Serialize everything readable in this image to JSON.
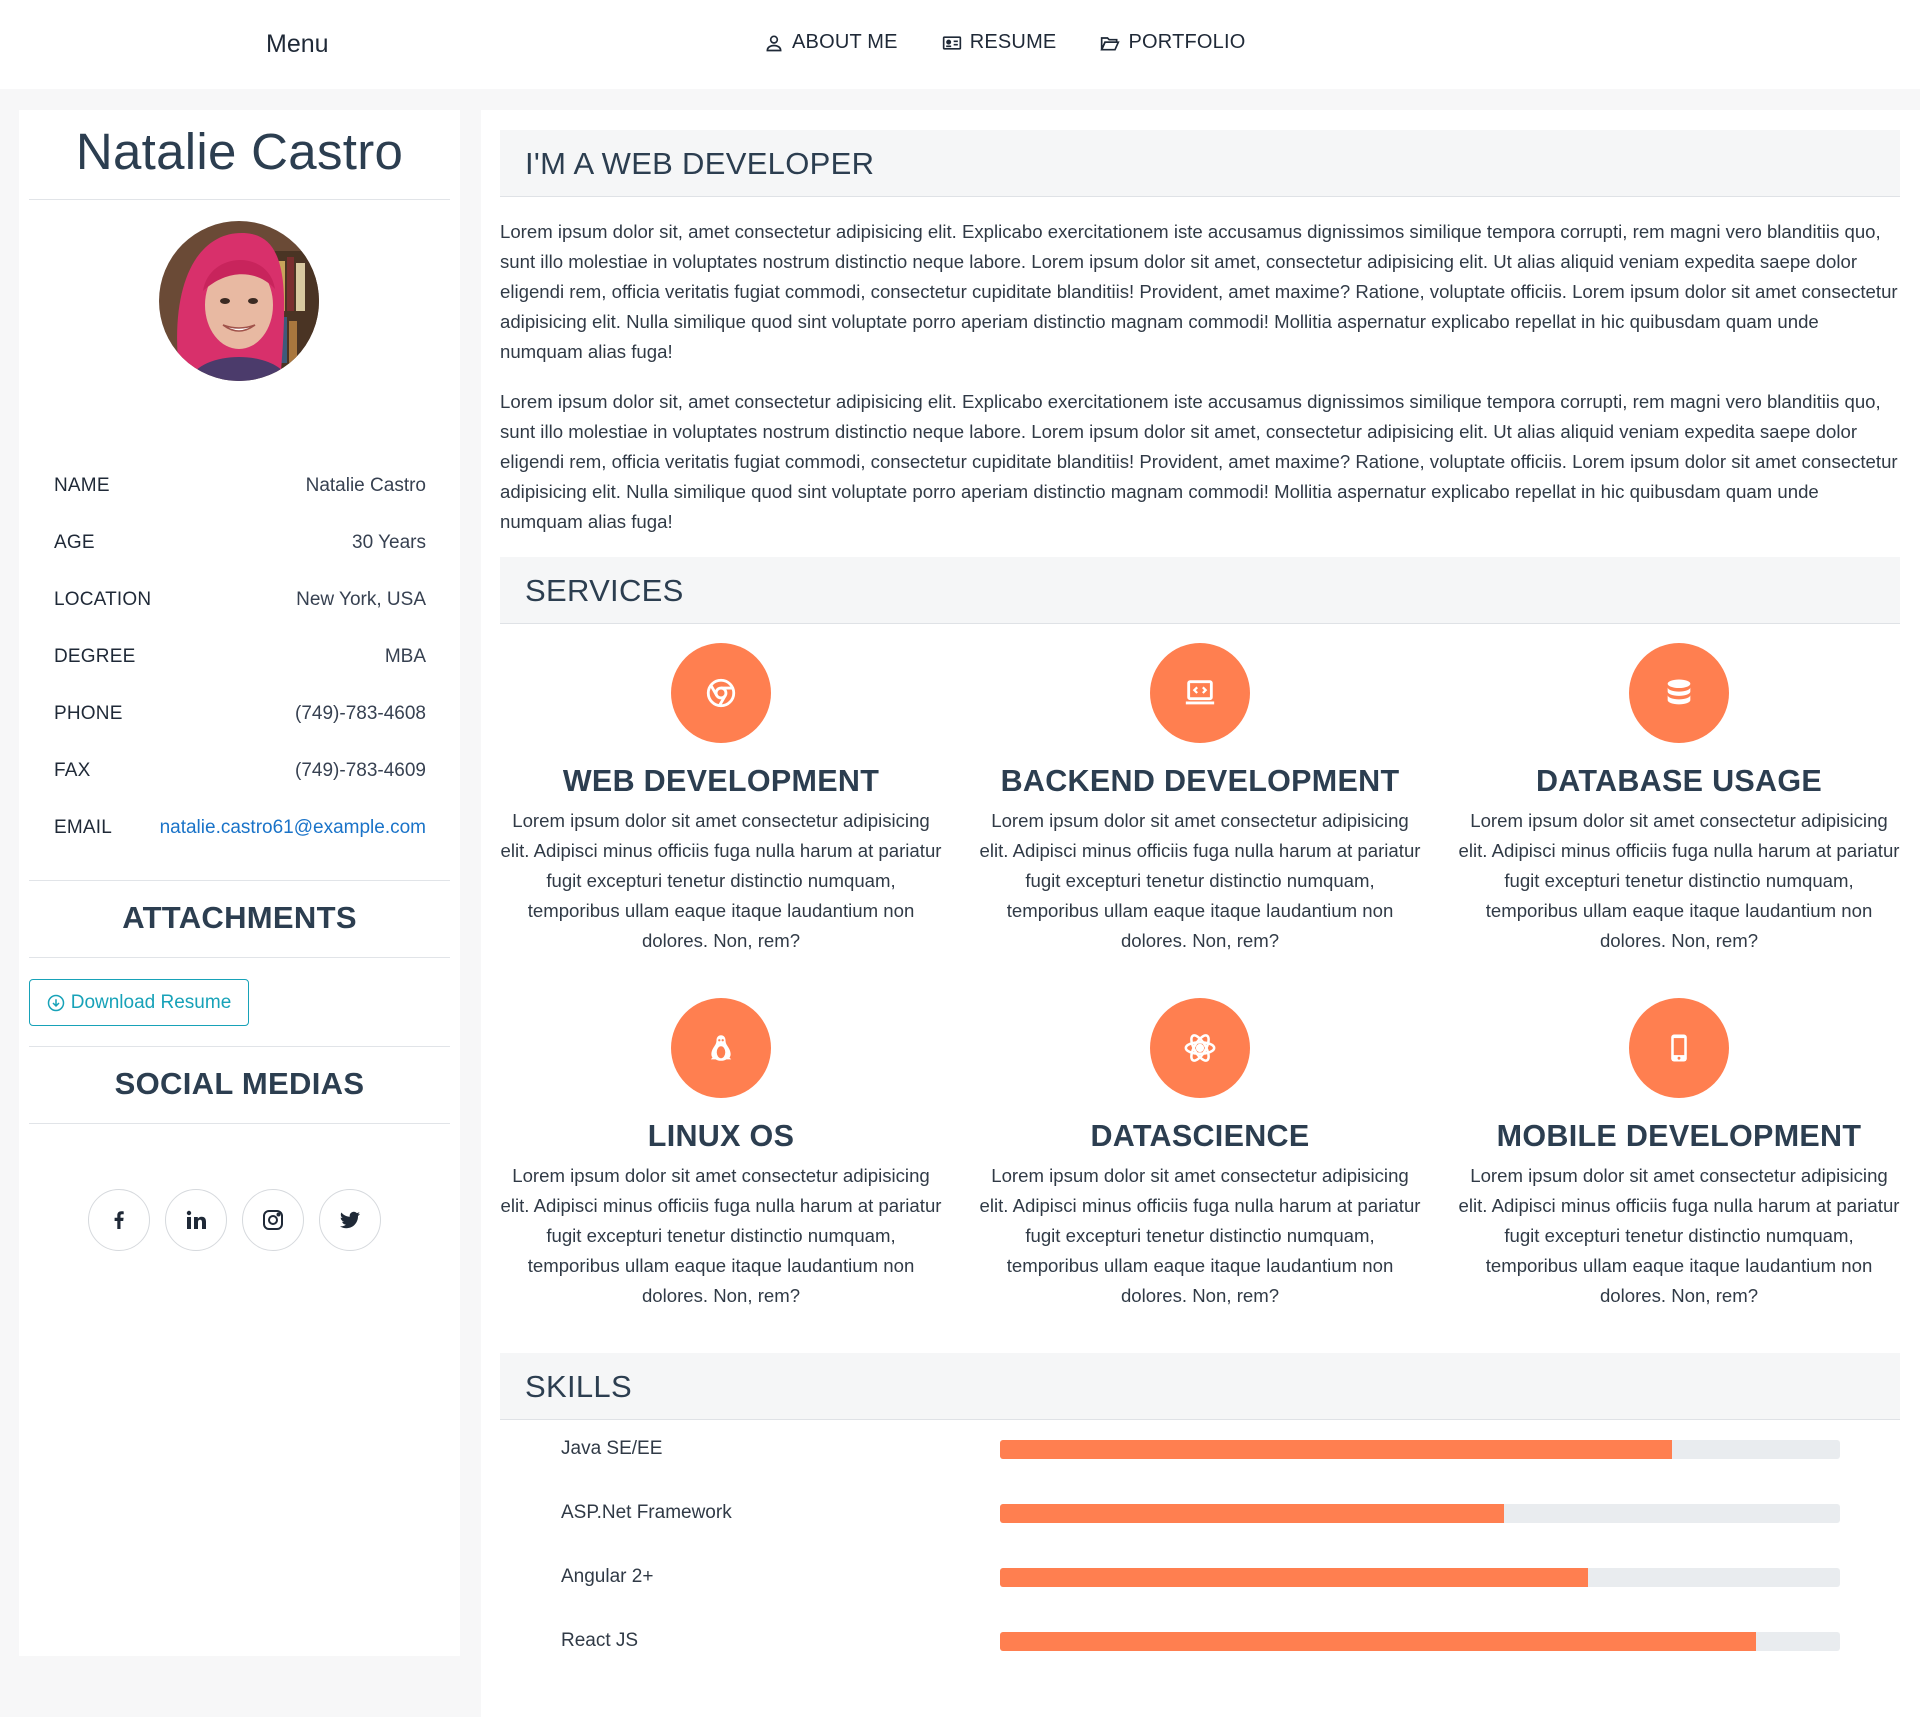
{
  "nav": {
    "menu_label": "Menu",
    "links": [
      {
        "label": "ABOUT ME",
        "icon": "user-icon"
      },
      {
        "label": "RESUME",
        "icon": "id-card-icon"
      },
      {
        "label": "PORTFOLIO",
        "icon": "folder-open-icon"
      }
    ]
  },
  "profile": {
    "name": "Natalie Castro",
    "avatar_icon": "avatar-photo",
    "info": [
      {
        "key": "NAME",
        "value": "Natalie Castro"
      },
      {
        "key": "AGE",
        "value": "30 Years"
      },
      {
        "key": "LOCATION",
        "value": "New York, USA"
      },
      {
        "key": "DEGREE",
        "value": "MBA"
      },
      {
        "key": "PHONE",
        "value": "(749)-783-4608"
      },
      {
        "key": "FAX",
        "value": "(749)-783-4609"
      },
      {
        "key": "EMAIL",
        "value": "natalie.castro61@example.com"
      }
    ],
    "attachments_heading": "ATTACHMENTS",
    "download_label": "Download Resume",
    "social_heading": "SOCIAL MEDIAS",
    "social": [
      "facebook-icon",
      "linkedin-icon",
      "instagram-icon",
      "twitter-icon"
    ]
  },
  "about": {
    "heading": "I'M A WEB DEVELOPER",
    "paragraphs": [
      "Lorem ipsum dolor sit, amet consectetur adipisicing elit. Explicabo exercitationem iste accusamus dignissimos similique tempora corrupti, rem magni vero blanditiis quo, sunt illo molestiae in voluptates nostrum distinctio neque labore. Lorem ipsum dolor sit amet, consectetur adipisicing elit. Ut alias aliquid veniam expedita saepe dolor eligendi rem, officia veritatis fugiat commodi, consectetur cupiditate blanditiis! Provident, amet maxime? Ratione, voluptate officiis. Lorem ipsum dolor sit amet consectetur adipisicing elit. Nulla similique quod sint voluptate porro aperiam distinctio magnam commodi! Mollitia aspernatur explicabo repellat in hic quibusdam quam unde numquam alias fuga!",
      "Lorem ipsum dolor sit, amet consectetur adipisicing elit. Explicabo exercitationem iste accusamus dignissimos similique tempora corrupti, rem magni vero blanditiis quo, sunt illo molestiae in voluptates nostrum distinctio neque labore. Lorem ipsum dolor sit amet, consectetur adipisicing elit. Ut alias aliquid veniam expedita saepe dolor eligendi rem, officia veritatis fugiat commodi, consectetur cupiditate blanditiis! Provident, amet maxime? Ratione, voluptate officiis. Lorem ipsum dolor sit amet consectetur adipisicing elit. Nulla similique quod sint voluptate porro aperiam distinctio magnam commodi! Mollitia aspernatur explicabo repellat in hic quibusdam quam unde numquam alias fuga!"
    ]
  },
  "services": {
    "heading": "SERVICES",
    "accent_color": "#ff7f50",
    "items": [
      {
        "title": "WEB DEVELOPMENT",
        "icon": "chrome-icon",
        "desc": "Lorem ipsum dolor sit amet consectetur adipisicing elit. Adipisci minus officiis fuga nulla harum at pariatur fugit excepturi tenetur distinctio numquam, temporibus ullam eaque itaque laudantium non dolores. Non, rem?"
      },
      {
        "title": "BACKEND DEVELOPMENT",
        "icon": "laptop-code-icon",
        "desc": "Lorem ipsum dolor sit amet consectetur adipisicing elit. Adipisci minus officiis fuga nulla harum at pariatur fugit excepturi tenetur distinctio numquam, temporibus ullam eaque itaque laudantium non dolores. Non, rem?"
      },
      {
        "title": "DATABASE USAGE",
        "icon": "database-icon",
        "desc": "Lorem ipsum dolor sit amet consectetur adipisicing elit. Adipisci minus officiis fuga nulla harum at pariatur fugit excepturi tenetur distinctio numquam, temporibus ullam eaque itaque laudantium non dolores. Non, rem?"
      },
      {
        "title": "LINUX OS",
        "icon": "linux-icon",
        "desc": "Lorem ipsum dolor sit amet consectetur adipisicing elit. Adipisci minus officiis fuga nulla harum at pariatur fugit excepturi tenetur distinctio numquam, temporibus ullam eaque itaque laudantium non dolores. Non, rem?"
      },
      {
        "title": "DATASCIENCE",
        "icon": "react-atom-icon",
        "desc": "Lorem ipsum dolor sit amet consectetur adipisicing elit. Adipisci minus officiis fuga nulla harum at pariatur fugit excepturi tenetur distinctio numquam, temporibus ullam eaque itaque laudantium non dolores. Non, rem?"
      },
      {
        "title": "MOBILE DEVELOPMENT",
        "icon": "mobile-icon",
        "desc": "Lorem ipsum dolor sit amet consectetur adipisicing elit. Adipisci minus officiis fuga nulla harum at pariatur fugit excepturi tenetur distinctio numquam, temporibus ullam eaque itaque laudantium non dolores. Non, rem?"
      }
    ]
  },
  "skills": {
    "heading": "SKILLS",
    "bar_color": "#ff7f50",
    "track_color": "#e9ecef",
    "items": [
      {
        "name": "Java SE/EE",
        "level": 0.8
      },
      {
        "name": "ASP.Net Framework",
        "level": 0.6
      },
      {
        "name": "Angular 2+",
        "level": 0.7
      },
      {
        "name": "React JS",
        "level": 0.9
      }
    ]
  }
}
